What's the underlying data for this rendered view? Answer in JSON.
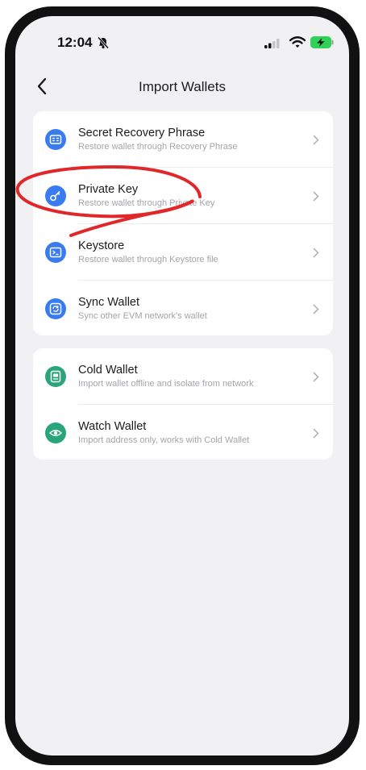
{
  "status_bar": {
    "time": "12:04"
  },
  "nav": {
    "title": "Import Wallets"
  },
  "groups": [
    {
      "items": [
        {
          "title": "Secret Recovery Phrase",
          "subtitle": "Restore wallet through Recovery Phrase",
          "icon": "recovery-phrase-icon",
          "color": "#3a7bf0"
        },
        {
          "title": "Private Key",
          "subtitle": "Restore wallet through Private Key",
          "icon": "key-icon",
          "color": "#3a7bf0"
        },
        {
          "title": "Keystore",
          "subtitle": "Restore wallet through Keystore file",
          "icon": "keystore-icon",
          "color": "#3a7bf0"
        },
        {
          "title": "Sync Wallet",
          "subtitle": "Sync other EVM network's wallet",
          "icon": "sync-icon",
          "color": "#3a7bf0"
        }
      ]
    },
    {
      "items": [
        {
          "title": "Cold Wallet",
          "subtitle": "Import wallet offline and isolate from network",
          "icon": "cold-wallet-icon",
          "color": "#2aa57a"
        },
        {
          "title": "Watch Wallet",
          "subtitle": "Import address only, works with Cold Wallet",
          "icon": "eye-icon",
          "color": "#2aa57a"
        }
      ]
    }
  ],
  "annotation_color": "#e0272a"
}
